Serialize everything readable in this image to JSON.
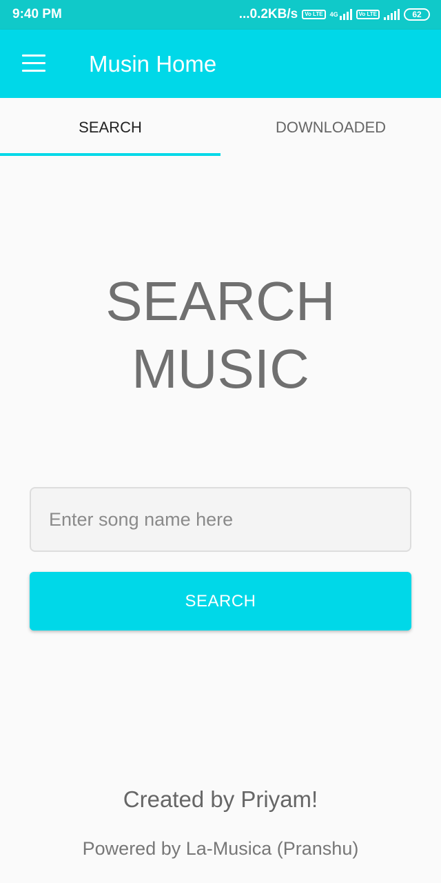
{
  "status_bar": {
    "time": "9:40 PM",
    "network_speed": "...0.2KB/s",
    "volte_badge_1": "Vo LTE",
    "network_label": "4G",
    "volte_badge_2": "Vo LTE",
    "battery_level": "62"
  },
  "app_bar": {
    "title": "Musin Home",
    "menu_icon": "hamburger-menu-icon"
  },
  "tabs": [
    {
      "label": "SEARCH",
      "active": true
    },
    {
      "label": "DOWNLOADED",
      "active": false
    }
  ],
  "main": {
    "hero_line_1": "SEARCH",
    "hero_line_2": "MUSIC",
    "search_input": {
      "value": "",
      "placeholder": "Enter song name here"
    },
    "search_button_label": "SEARCH"
  },
  "footer": {
    "created_by": "Created by Priyam!",
    "powered_by": "Powered by La-Musica (Pranshu)"
  },
  "colors": {
    "status_bar": "#10c9c9",
    "accent": "#00d8e8",
    "background": "#fafafa"
  }
}
